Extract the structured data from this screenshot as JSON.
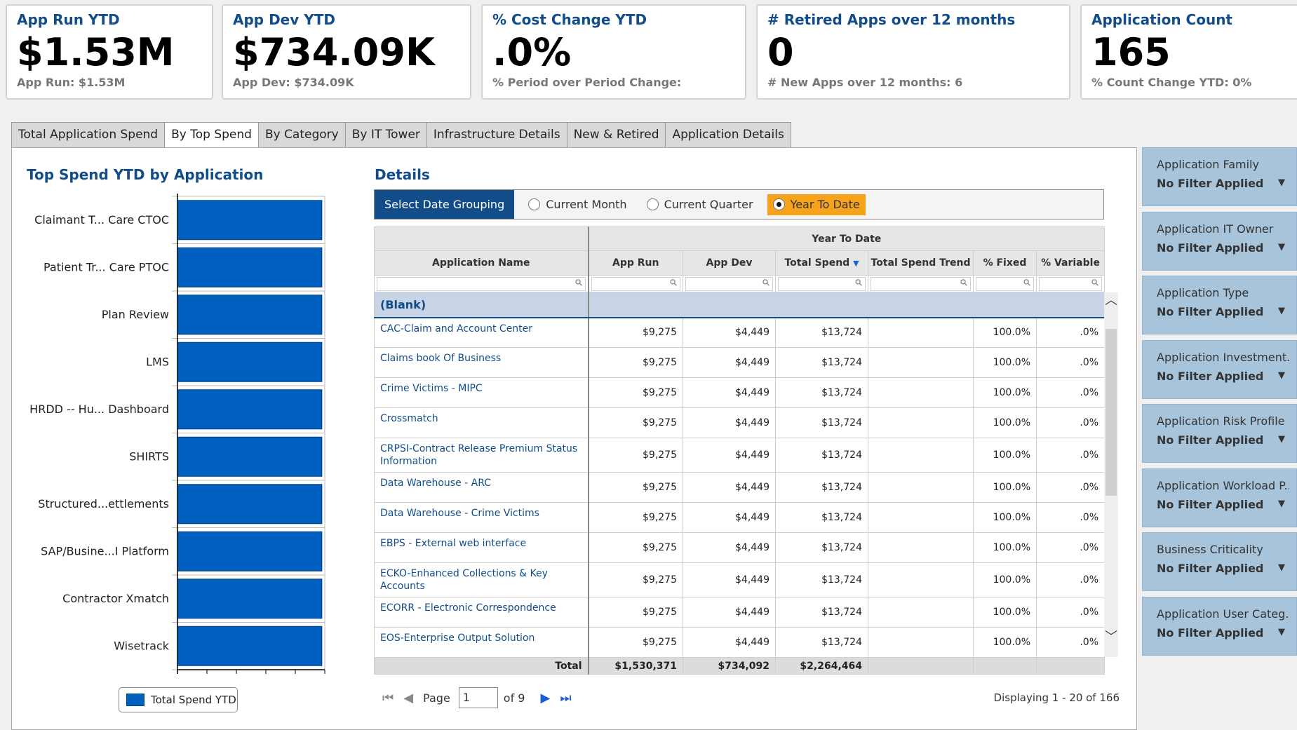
{
  "kpis": [
    {
      "title": "App Run YTD",
      "value": "$1.53M",
      "sub": "App Run: $1.53M"
    },
    {
      "title": "App Dev YTD",
      "value": "$734.09K",
      "sub": "App Dev: $734.09K"
    },
    {
      "title": "% Cost Change YTD",
      "value": ".0%",
      "sub": "% Period over Period Change:"
    },
    {
      "title": "# Retired Apps over 12 months",
      "value": "0",
      "sub": "# New Apps over 12 months: 6"
    },
    {
      "title": "Application Count",
      "value": "165",
      "sub": "% Count Change YTD: 0%"
    }
  ],
  "tabs": [
    {
      "label": "Total Application Spend"
    },
    {
      "label": "By Top Spend",
      "active": true
    },
    {
      "label": "By Category"
    },
    {
      "label": "By IT Tower"
    },
    {
      "label": "Infrastructure Details"
    },
    {
      "label": "New & Retired"
    },
    {
      "label": "Application Details"
    }
  ],
  "chart": {
    "title": "Top Spend YTD by Application",
    "legend": "Total Spend YTD",
    "bar_color": "#0060bf"
  },
  "chart_data": {
    "type": "bar",
    "orientation": "horizontal",
    "title": "Top Spend YTD by Application",
    "categories": [
      "Claimant T... Care CTOC",
      "Patient Tr... Care PTOC",
      "Plan Review",
      "LMS",
      "HRDD -- Hu... Dashboard",
      "SHIRTS",
      "Structured...ettlements",
      "SAP/Busine...I Platform",
      "Contractor Xmatch",
      "Wisetrack"
    ],
    "series": [
      {
        "name": "Total Spend YTD",
        "values": [
          13724,
          13724,
          13724,
          13724,
          13724,
          13724,
          13724,
          13724,
          13724,
          13724
        ]
      }
    ],
    "x_tick_labels": [
      "$0"
    ],
    "xlim": [
      0,
      14000
    ],
    "legend_position": "bottom"
  },
  "details": {
    "title": "Details",
    "date_group_label": "Select Date Grouping",
    "date_options": [
      {
        "label": "Current Month",
        "selected": false
      },
      {
        "label": "Current Quarter",
        "selected": false
      },
      {
        "label": "Year To Date",
        "selected": true
      }
    ],
    "group_header": "Year To Date",
    "columns": [
      "Application Name",
      "App Run",
      "App Dev",
      "Total Spend",
      "Total Spend Trend",
      "% Fixed",
      "% Variable"
    ],
    "blank_group": "(Blank)",
    "rows": [
      {
        "name": "CAC-Claim and Account Center",
        "run": "$9,275",
        "dev": "$4,449",
        "total": "$13,724",
        "trend": "",
        "fixed": "100.0%",
        "variable": ".0%"
      },
      {
        "name": "Claims book Of Business",
        "run": "$9,275",
        "dev": "$4,449",
        "total": "$13,724",
        "trend": "",
        "fixed": "100.0%",
        "variable": ".0%"
      },
      {
        "name": "Crime Victims - MIPC",
        "run": "$9,275",
        "dev": "$4,449",
        "total": "$13,724",
        "trend": "",
        "fixed": "100.0%",
        "variable": ".0%"
      },
      {
        "name": "Crossmatch",
        "run": "$9,275",
        "dev": "$4,449",
        "total": "$13,724",
        "trend": "",
        "fixed": "100.0%",
        "variable": ".0%"
      },
      {
        "name": "CRPSI-Contract Release Premium Status Information",
        "run": "$9,275",
        "dev": "$4,449",
        "total": "$13,724",
        "trend": "",
        "fixed": "100.0%",
        "variable": ".0%"
      },
      {
        "name": "Data Warehouse - ARC",
        "run": "$9,275",
        "dev": "$4,449",
        "total": "$13,724",
        "trend": "",
        "fixed": "100.0%",
        "variable": ".0%"
      },
      {
        "name": "Data Warehouse - Crime Victims",
        "run": "$9,275",
        "dev": "$4,449",
        "total": "$13,724",
        "trend": "",
        "fixed": "100.0%",
        "variable": ".0%"
      },
      {
        "name": "EBPS - External web interface",
        "run": "$9,275",
        "dev": "$4,449",
        "total": "$13,724",
        "trend": "",
        "fixed": "100.0%",
        "variable": ".0%"
      },
      {
        "name": "ECKO-Enhanced Collections & Key Accounts",
        "run": "$9,275",
        "dev": "$4,449",
        "total": "$13,724",
        "trend": "",
        "fixed": "100.0%",
        "variable": ".0%"
      },
      {
        "name": "ECORR - Electronic Correspondence",
        "run": "$9,275",
        "dev": "$4,449",
        "total": "$13,724",
        "trend": "",
        "fixed": "100.0%",
        "variable": ".0%"
      },
      {
        "name": "EOS-Enterprise Output Solution",
        "run": "$9,275",
        "dev": "$4,449",
        "total": "$13,724",
        "trend": "",
        "fixed": "100.0%",
        "variable": ".0%"
      }
    ],
    "total": {
      "label": "Total",
      "run": "$1,530,371",
      "dev": "$734,092",
      "total": "$2,264,464"
    },
    "pager": {
      "page_label": "Page",
      "page_value": "1",
      "of_label": "of 9",
      "displaying": "Displaying 1 - 20 of 166"
    }
  },
  "filters": [
    {
      "name": "Application Family",
      "value": "No Filter Applied"
    },
    {
      "name": "Application IT Owner",
      "value": "No Filter Applied"
    },
    {
      "name": "Application Type",
      "value": "No Filter Applied"
    },
    {
      "name": "Application Investment...",
      "value": "No Filter Applied"
    },
    {
      "name": "Application Risk Profile",
      "value": "No Filter Applied"
    },
    {
      "name": "Application Workload P...",
      "value": "No Filter Applied"
    },
    {
      "name": "Business Criticality",
      "value": "No Filter Applied"
    },
    {
      "name": "Application User Categ...",
      "value": "No Filter Applied"
    }
  ]
}
